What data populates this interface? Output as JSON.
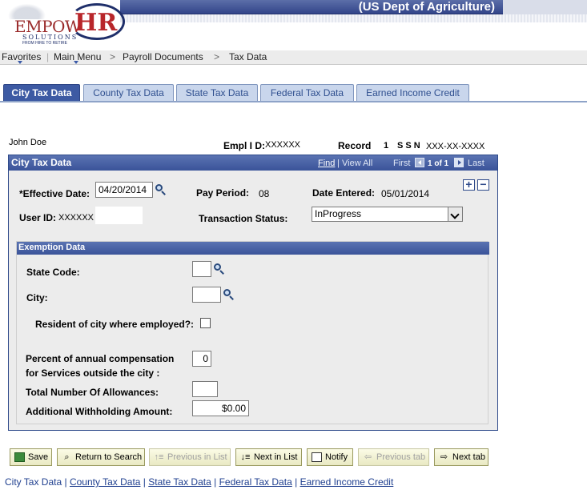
{
  "header": {
    "logo_main": "EMPOW",
    "logo_hr": "HR",
    "logo_sub": "SOLUTIONS",
    "logo_tag": "FROM HIRE TO RETIRE",
    "agency": "(US Dept of Agriculture)"
  },
  "nav": {
    "favorites": "Favorites",
    "main_menu": "Main Menu",
    "sep1": ">",
    "payroll": "Payroll Documents",
    "sep2": ">",
    "tax": "Tax Data"
  },
  "tabs": [
    {
      "label": "City Tax Data"
    },
    {
      "label": "County Tax Data"
    },
    {
      "label": "State Tax Data"
    },
    {
      "label": "Federal Tax Data"
    },
    {
      "label": "Earned Income Credit"
    }
  ],
  "employee": {
    "name": "John Doe",
    "empl_id_label": "Empl I D:",
    "empl_id": "XXXXXX",
    "record_label": "Record",
    "record": "1",
    "ssn_label": "S S N",
    "ssn": "XXX-XX-XXXX"
  },
  "panel": {
    "title": "City Tax Data",
    "find": "Find",
    "divider": "|",
    "view_all": "View All",
    "first": "First",
    "count": "1 of 1",
    "last": "Last",
    "plus": "+",
    "minus": "−"
  },
  "form": {
    "effective_date_label": "*Effective Date:",
    "effective_date": "04/20/2014",
    "pay_period_label": "Pay Period:",
    "pay_period": "08",
    "date_entered_label": "Date Entered:",
    "date_entered": "05/01/2014",
    "user_id_label": "User ID:",
    "user_id": "XXXXXX",
    "transaction_status_label": "Transaction Status:",
    "transaction_status": "InProgress"
  },
  "exemption": {
    "title": "Exemption Data",
    "state_code_label": "State Code:",
    "city_label": "City:",
    "resident_label": "Resident of city where employed?:",
    "percent_label_1": "Percent of annual compensation",
    "percent_label_2": "for Services outside the city :",
    "percent_value": "0",
    "allowances_label": "Total Number Of Allowances:",
    "withholding_label": "Additional Withholding Amount:",
    "withholding_value": "$0.00"
  },
  "buttons": {
    "save": "Save",
    "return_to_search": "Return to Search",
    "previous_in_list": "Previous in List",
    "next_in_list": "Next in List",
    "notify": "Notify",
    "previous_tab": "Previous tab",
    "next_tab": "Next tab"
  },
  "footer_links": [
    {
      "label": "City Tax Data"
    },
    {
      "label": "County Tax Data"
    },
    {
      "label": "State Tax Data"
    },
    {
      "label": "Federal Tax Data"
    },
    {
      "label": "Earned Income Credit"
    }
  ],
  "footer_separator": "|",
  "colors": {
    "header_blue": "#3d5aa3",
    "tab_inactive": "#c9d6ec",
    "panel_bg": "#ececec",
    "button_bg": "#fbfbe6",
    "link_blue": "#1f3f8f"
  }
}
